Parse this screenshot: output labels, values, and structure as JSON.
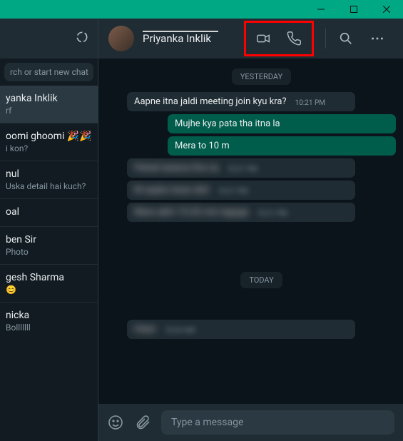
{
  "header": {
    "contact_name": "Priyanka Inklik"
  },
  "sidebar": {
    "search_placeholder": "rch or start new chat",
    "chats": [
      {
        "name": "yanka Inklik",
        "preview": "rf"
      },
      {
        "name": "oomi ghoomi 🎉🎉",
        "preview": "i kon?"
      },
      {
        "name": "nul",
        "preview": "Uska detail hai kuch?"
      },
      {
        "name": "oal",
        "preview": ""
      },
      {
        "name": "ben Sir",
        "preview": "Photo"
      },
      {
        "name": "gesh Sharma",
        "preview": "😊"
      },
      {
        "name": "nicka",
        "preview": "Bolllllll"
      }
    ]
  },
  "messages": {
    "date1": "YESTERDAY",
    "date2": "TODAY",
    "m1": {
      "text": "Aapne itna jaldi meeting join kyu kra?",
      "time": "10:21 PM"
    },
    "m2": {
      "text": "Mujhe kya pata tha itna la"
    },
    "m3": {
      "text": "Mera to 10 m"
    },
    "m4": {
      "text": "Pahali batana tha na",
      "time": "10:21 PM"
    },
    "m5": {
      "text": "M aapko kese deti",
      "time": "10:21 PM"
    },
    "m6": {
      "text": "Mere abhi 15-20 min lagege",
      "time": "10:21 PM"
    },
    "m7": {
      "text": "Haan",
      "time": "10:24 AM"
    }
  },
  "composer": {
    "placeholder": "Type a message"
  }
}
